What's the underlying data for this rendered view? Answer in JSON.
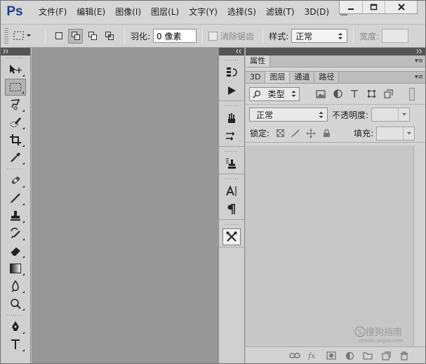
{
  "app": {
    "logo": "Ps",
    "menus": [
      "文件(F)",
      "编辑(E)",
      "图像(I)",
      "图层(L)",
      "文字(Y)",
      "选择(S)",
      "滤镜(T)",
      "3D(D)",
      "视"
    ]
  },
  "options_bar": {
    "feather_label": "羽化:",
    "feather_value": "0 像素",
    "antialias_label": "消除锯齿",
    "style_label": "样式:",
    "style_value": "正常",
    "width_label": "宽度:"
  },
  "tools": [
    "move",
    "rectangular-marquee",
    "lasso",
    "quick-selection",
    "crop",
    "eyedropper",
    "spot-healing",
    "brush",
    "clone-stamp",
    "history-brush",
    "eraser",
    "gradient",
    "blur",
    "dodge",
    "pen",
    "type"
  ],
  "right_panel": {
    "properties_tab": "属性",
    "tabs": [
      "3D",
      "图层",
      "通道",
      "路径"
    ],
    "active_tab": "图层",
    "kind_label": "类型",
    "blend_mode": "正常",
    "opacity_label": "不透明度:",
    "lock_label": "锁定:",
    "fill_label": "填充:"
  },
  "watermark": {
    "text": "搜狗指南",
    "url": "zhinan.sogou.com"
  },
  "colors": {
    "menubar": "#d6d6d6",
    "canvas": "#979797",
    "panel": "#d5d5d5",
    "logo": "#1c3f8c"
  }
}
